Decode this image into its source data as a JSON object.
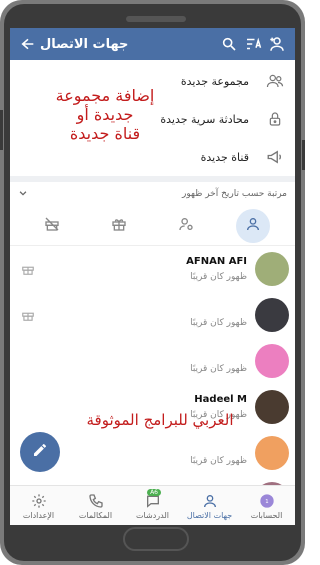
{
  "header": {
    "title": "جهات الاتصال"
  },
  "actions": [
    {
      "label": "مجموعة جديدة"
    },
    {
      "label": "محادثة سرية جديدة"
    },
    {
      "label": "قناة جديدة"
    }
  ],
  "overlay": {
    "line1": "إضافة مجموعة",
    "line2": "جديدة أو",
    "line3": "قناة جديدة",
    "bottom": "العربي للبرامج الموثوقة"
  },
  "sort": {
    "label": "مرتبة حسب تاريخ آخر ظهور"
  },
  "contacts": [
    {
      "name": "AFNAN AFI",
      "status": "ظهور كان قريبًا",
      "avatar_color": "#9fae78"
    },
    {
      "name": "",
      "status": "ظهور كان قريبًا",
      "avatar_color": "#3a3a40"
    },
    {
      "name": "",
      "status": "ظهور كان قريبًا",
      "avatar_color": "#ec7fc0"
    },
    {
      "name": "Hadeel M",
      "status": "ظهور كان قريبًا",
      "avatar_color": "#4a3b30"
    },
    {
      "name": "",
      "status": "ظهور كان قريبًا",
      "avatar_color": "#f0a060"
    },
    {
      "name": "",
      "status": "",
      "avatar_color": "#a07080"
    }
  ],
  "bottom_nav": [
    {
      "label": "الحسابات",
      "icon": "account-icon",
      "active": false
    },
    {
      "label": "جهات الاتصال",
      "icon": "person-icon",
      "active": true
    },
    {
      "label": "الدردشات",
      "icon": "chat-icon",
      "active": false,
      "badge": "A6"
    },
    {
      "label": "المكالمات",
      "icon": "phone-icon",
      "active": false
    },
    {
      "label": "الإعدادات",
      "icon": "gear-icon",
      "active": false
    }
  ],
  "colors": {
    "accent": "#4a6fa5",
    "overlay_text": "#c31d1d"
  }
}
